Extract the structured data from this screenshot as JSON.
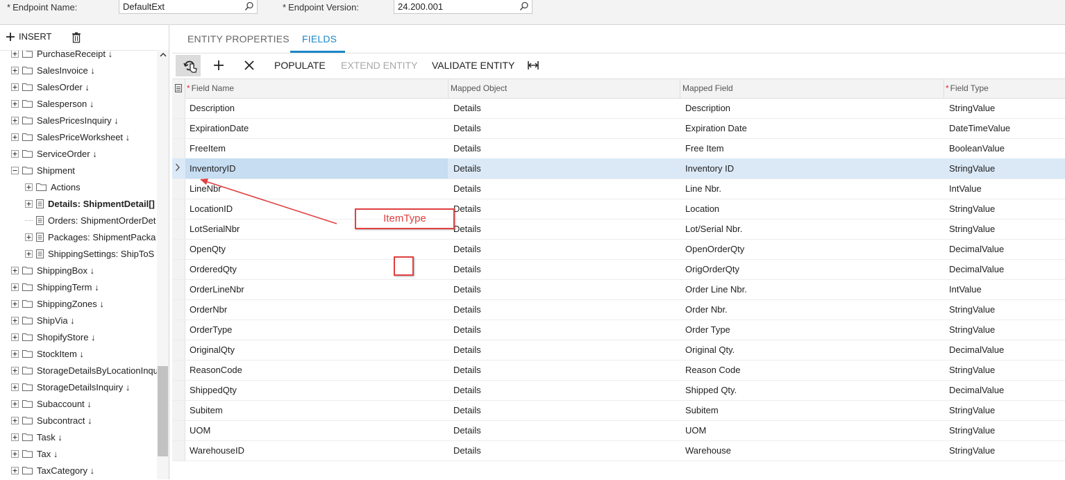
{
  "header": {
    "endpoint_name_label": "Endpoint Name:",
    "endpoint_name_value": "DefaultExt",
    "endpoint_version_label": "Endpoint Version:",
    "endpoint_version_value": "24.200.001",
    "required_mark": "*"
  },
  "sidebar": {
    "insert_label": "INSERT",
    "tree": [
      {
        "label": "PurchaseReceipt ↓",
        "level": 0,
        "kind": "folder",
        "expandable": true
      },
      {
        "label": "SalesInvoice ↓",
        "level": 0,
        "kind": "folder",
        "expandable": true
      },
      {
        "label": "SalesOrder ↓",
        "level": 0,
        "kind": "folder",
        "expandable": true
      },
      {
        "label": "Salesperson ↓",
        "level": 0,
        "kind": "folder",
        "expandable": true
      },
      {
        "label": "SalesPricesInquiry ↓",
        "level": 0,
        "kind": "folder",
        "expandable": true
      },
      {
        "label": "SalesPriceWorksheet ↓",
        "level": 0,
        "kind": "folder",
        "expandable": true
      },
      {
        "label": "ServiceOrder ↓",
        "level": 0,
        "kind": "folder",
        "expandable": true
      },
      {
        "label": "Shipment",
        "level": 0,
        "kind": "folder",
        "expandable": true,
        "expanded": true
      },
      {
        "label": "Actions",
        "level": 1,
        "kind": "folder",
        "expandable": true
      },
      {
        "label": "Details: ShipmentDetail[]",
        "level": 1,
        "kind": "doc",
        "expandable": true,
        "bold": true
      },
      {
        "label": "Orders: ShipmentOrderDet",
        "level": 1,
        "kind": "doc",
        "expandable": false
      },
      {
        "label": "Packages: ShipmentPacka",
        "level": 1,
        "kind": "doc",
        "expandable": true
      },
      {
        "label": "ShippingSettings: ShipToS",
        "level": 1,
        "kind": "doc",
        "expandable": true
      },
      {
        "label": "ShippingBox ↓",
        "level": 0,
        "kind": "folder",
        "expandable": true
      },
      {
        "label": "ShippingTerm ↓",
        "level": 0,
        "kind": "folder",
        "expandable": true
      },
      {
        "label": "ShippingZones ↓",
        "level": 0,
        "kind": "folder",
        "expandable": true
      },
      {
        "label": "ShipVia ↓",
        "level": 0,
        "kind": "folder",
        "expandable": true
      },
      {
        "label": "ShopifyStore ↓",
        "level": 0,
        "kind": "folder",
        "expandable": true
      },
      {
        "label": "StockItem ↓",
        "level": 0,
        "kind": "folder",
        "expandable": true
      },
      {
        "label": "StorageDetailsByLocationInqu",
        "level": 0,
        "kind": "folder",
        "expandable": true
      },
      {
        "label": "StorageDetailsInquiry ↓",
        "level": 0,
        "kind": "folder",
        "expandable": true
      },
      {
        "label": "Subaccount ↓",
        "level": 0,
        "kind": "folder",
        "expandable": true
      },
      {
        "label": "Subcontract ↓",
        "level": 0,
        "kind": "folder",
        "expandable": true
      },
      {
        "label": "Task ↓",
        "level": 0,
        "kind": "folder",
        "expandable": true
      },
      {
        "label": "Tax ↓",
        "level": 0,
        "kind": "folder",
        "expandable": true
      },
      {
        "label": "TaxCategory ↓",
        "level": 0,
        "kind": "folder",
        "expandable": true
      }
    ]
  },
  "tabs": [
    {
      "label": "ENTITY PROPERTIES",
      "active": false
    },
    {
      "label": "FIELDS",
      "active": true
    }
  ],
  "toolbar": {
    "populate_label": "POPULATE",
    "extend_entity_label": "EXTEND ENTITY",
    "validate_entity_label": "VALIDATE ENTITY"
  },
  "grid": {
    "columns": [
      {
        "label": "Field Name",
        "required": true
      },
      {
        "label": "Mapped Object",
        "required": false
      },
      {
        "label": "Mapped Field",
        "required": false
      },
      {
        "label": "Field Type",
        "required": true
      }
    ],
    "selected_row": 3,
    "rows": [
      [
        "Description",
        "Details",
        "Description",
        "StringValue"
      ],
      [
        "ExpirationDate",
        "Details",
        "Expiration Date",
        "DateTimeValue"
      ],
      [
        "FreeItem",
        "Details",
        "Free Item",
        "BooleanValue"
      ],
      [
        "InventoryID",
        "Details",
        "Inventory ID",
        "StringValue"
      ],
      [
        "LineNbr",
        "Details",
        "Line Nbr.",
        "IntValue"
      ],
      [
        "LocationID",
        "Details",
        "Location",
        "StringValue"
      ],
      [
        "LotSerialNbr",
        "Details",
        "Lot/Serial Nbr.",
        "StringValue"
      ],
      [
        "OpenQty",
        "Details",
        "OpenOrderQty",
        "DecimalValue"
      ],
      [
        "OrderedQty",
        "Details",
        "OrigOrderQty",
        "DecimalValue"
      ],
      [
        "OrderLineNbr",
        "Details",
        "Order Line Nbr.",
        "IntValue"
      ],
      [
        "OrderNbr",
        "Details",
        "Order Nbr.",
        "StringValue"
      ],
      [
        "OrderType",
        "Details",
        "Order Type",
        "StringValue"
      ],
      [
        "OriginalQty",
        "Details",
        "Original Qty.",
        "DecimalValue"
      ],
      [
        "ReasonCode",
        "Details",
        "Reason Code",
        "StringValue"
      ],
      [
        "ShippedQty",
        "Details",
        "Shipped Qty.",
        "DecimalValue"
      ],
      [
        "Subitem",
        "Details",
        "Subitem",
        "StringValue"
      ],
      [
        "UOM",
        "Details",
        "UOM",
        "StringValue"
      ],
      [
        "WarehouseID",
        "Details",
        "Warehouse",
        "StringValue"
      ]
    ]
  },
  "annotation": {
    "label": "ItemType",
    "color": "#e04040"
  },
  "colors": {
    "accent": "#1c87c9",
    "selected_row": "#dbe9f7",
    "required_star": "#e52727"
  }
}
